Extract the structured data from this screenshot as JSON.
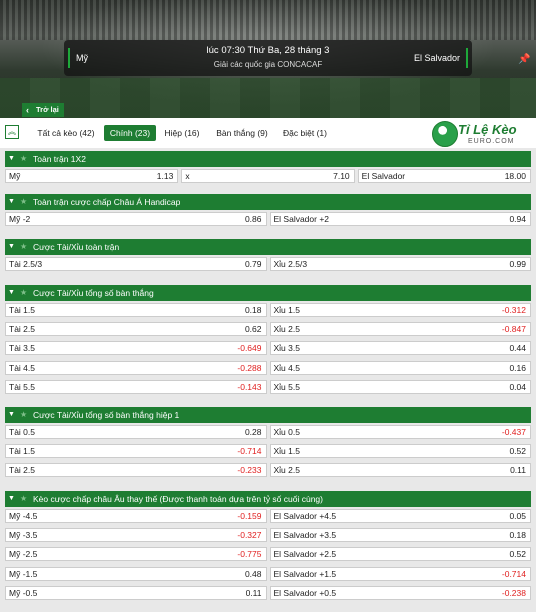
{
  "match": {
    "home": "Mỹ",
    "away": "El Salvador",
    "time": "lúc 07:30 Thứ Ba, 28 tháng 3",
    "league": "Giải các quốc gia CONCACAF"
  },
  "back_label": "Trở lại",
  "tabs": [
    {
      "label": "Tất cả kèo (42)"
    },
    {
      "label": "Chính (23)",
      "active": true
    },
    {
      "label": "Hiệp (16)"
    },
    {
      "label": "Bàn thắng (9)"
    },
    {
      "label": "Đặc biệt (1)"
    }
  ],
  "logo": {
    "text": "Tỉ Lệ Kèo",
    "sub": "EURO.COM"
  },
  "sections": [
    {
      "title": "Toàn trận 1X2",
      "rows": [
        [
          {
            "l": "Mỹ",
            "r": "1.13"
          },
          {
            "l": "x",
            "r": "7.10"
          },
          {
            "l": "El Salvador",
            "r": "18.00"
          }
        ]
      ]
    },
    {
      "title": "Toàn trận cược chấp Châu Á Handicap",
      "rows": [
        [
          {
            "l": "Mỹ -2",
            "r": "0.86"
          },
          {
            "l": "El Salvador +2",
            "r": "0.94"
          }
        ]
      ]
    },
    {
      "title": "Cược Tài/Xỉu toàn trận",
      "rows": [
        [
          {
            "l": "Tài 2.5/3",
            "r": "0.79"
          },
          {
            "l": "Xỉu 2.5/3",
            "r": "0.99"
          }
        ]
      ]
    },
    {
      "title": "Cược Tài/Xỉu tổng số bàn thắng",
      "rows": [
        [
          {
            "l": "Tài 1.5",
            "r": "0.18"
          },
          {
            "l": "Xỉu 1.5",
            "r": "-0.312"
          }
        ],
        [
          {
            "l": "Tài 2.5",
            "r": "0.62"
          },
          {
            "l": "Xỉu 2.5",
            "r": "-0.847"
          }
        ],
        [
          {
            "l": "Tài 3.5",
            "r": "-0.649"
          },
          {
            "l": "Xỉu 3.5",
            "r": "0.44"
          }
        ],
        [
          {
            "l": "Tài 4.5",
            "r": "-0.288"
          },
          {
            "l": "Xỉu 4.5",
            "r": "0.16"
          }
        ],
        [
          {
            "l": "Tài 5.5",
            "r": "-0.143"
          },
          {
            "l": "Xỉu 5.5",
            "r": "0.04"
          }
        ]
      ]
    },
    {
      "title": "Cược Tài/Xỉu tổng số bàn thắng hiệp 1",
      "rows": [
        [
          {
            "l": "Tài 0.5",
            "r": "0.28"
          },
          {
            "l": "Xỉu 0.5",
            "r": "-0.437"
          }
        ],
        [
          {
            "l": "Tài 1.5",
            "r": "-0.714"
          },
          {
            "l": "Xỉu 1.5",
            "r": "0.52"
          }
        ],
        [
          {
            "l": "Tài 2.5",
            "r": "-0.233"
          },
          {
            "l": "Xỉu 2.5",
            "r": "0.11"
          }
        ]
      ]
    },
    {
      "title": "Kèo cược chấp châu Âu thay thế (Được thanh toán dựa trên tỷ số cuối cùng)",
      "rows": [
        [
          {
            "l": "Mỹ -4.5",
            "r": "-0.159"
          },
          {
            "l": "El Salvador +4.5",
            "r": "0.05"
          }
        ],
        [
          {
            "l": "Mỹ -3.5",
            "r": "-0.327"
          },
          {
            "l": "El Salvador +3.5",
            "r": "0.18"
          }
        ],
        [
          {
            "l": "Mỹ -2.5",
            "r": "-0.775"
          },
          {
            "l": "El Salvador +2.5",
            "r": "0.52"
          }
        ],
        [
          {
            "l": "Mỹ -1.5",
            "r": "0.48"
          },
          {
            "l": "El Salvador +1.5",
            "r": "-0.714"
          }
        ],
        [
          {
            "l": "Mỹ -0.5",
            "r": "0.11"
          },
          {
            "l": "El Salvador +0.5",
            "r": "-0.238"
          }
        ]
      ]
    }
  ],
  "colors": {
    "accent": "#1e7d32",
    "negative": "#e02020"
  }
}
